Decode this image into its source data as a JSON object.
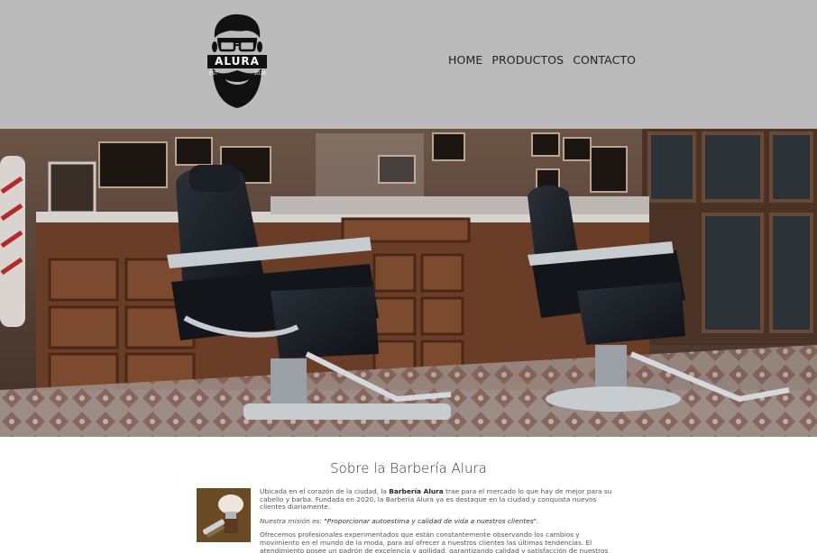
{
  "header": {
    "logo": {
      "brand": "ALURA",
      "est_left": "EST",
      "est_right": "2020"
    },
    "nav": [
      {
        "label": "HOME"
      },
      {
        "label": "PRODUCTOS"
      },
      {
        "label": "CONTACTO"
      }
    ],
    "background": "#bbbbbb"
  },
  "about": {
    "title": "Sobre la Barbería Alura",
    "p1_before": "Ubicada en el corazón de la ciudad, la ",
    "p1_strong": "Barbería Alura",
    "p1_after": " trae para el mercado lo que hay de mejor para su cabello y barba. Fundada en 2020, la Barbería Alura ya es destaque en la ciudad y conquista nuevos clientes diariamente.",
    "mission_label": "Nuestra misión es:",
    "mission_quote": "\"Proporcionar autoestima y calidad de vida a nuestros clientes\".",
    "p3": "Ofrecemos profesionales experimentados que están constantemente observando los cambios y movimiento en el mundo de la moda, para así ofrecer a nuestros clientes las últimas tendencias. El atendimiento posee un padrón de excelencia y agilidad, garantizando calidad y satisfacción de nuestros clientes."
  }
}
